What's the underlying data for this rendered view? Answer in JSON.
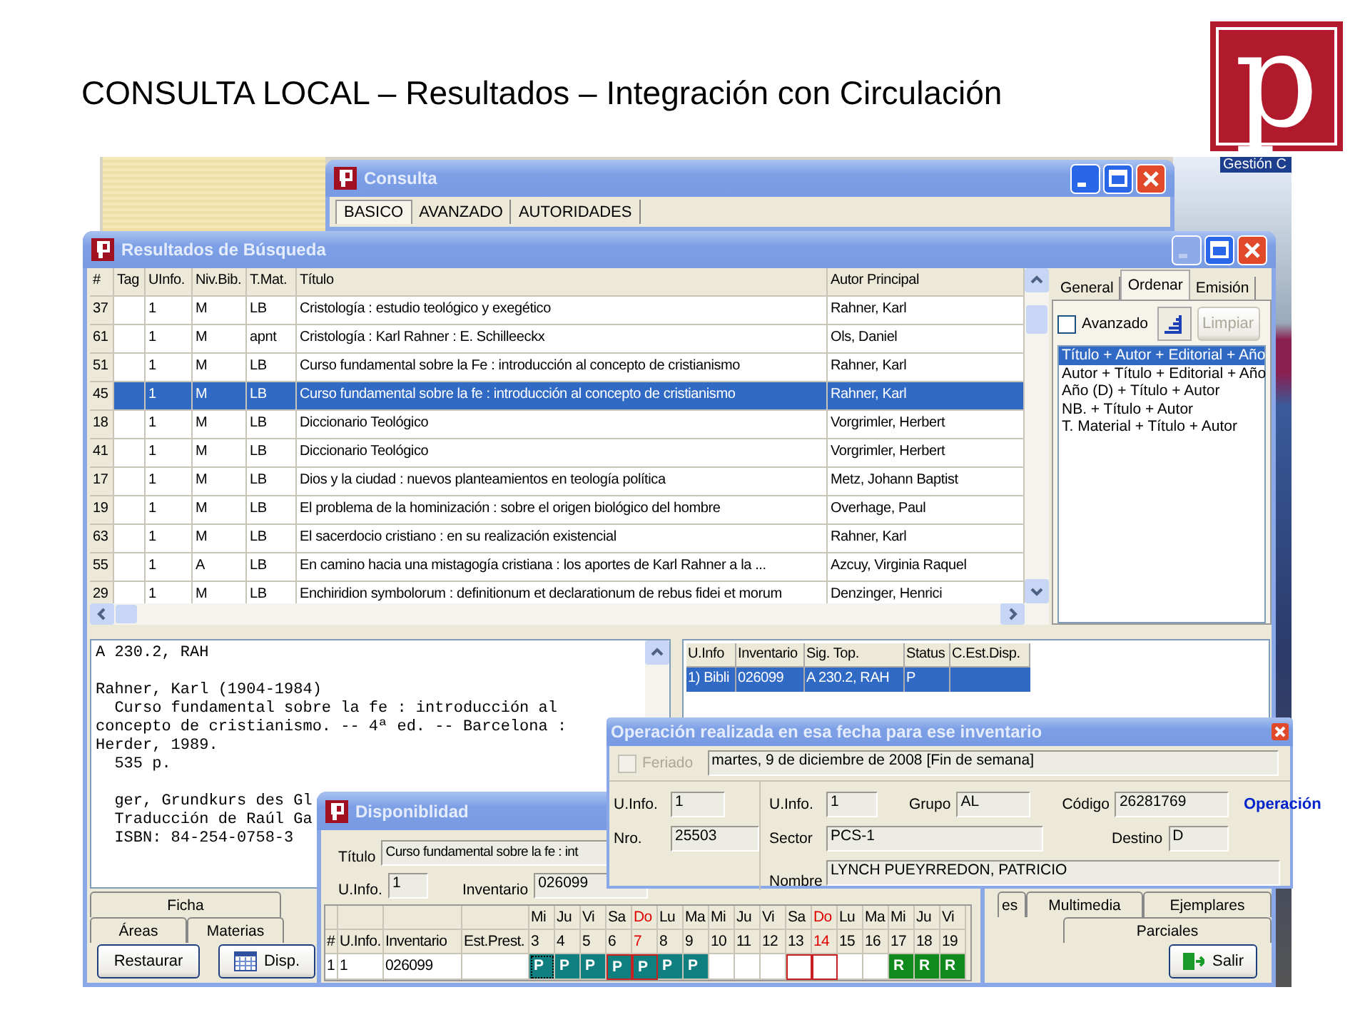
{
  "slide_title": "CONSULTA LOCAL – Resultados – Integración con Circulación",
  "logo_text": "p",
  "desktop_label": "Gestión C",
  "consulta": {
    "title": "Consulta",
    "minimize_enabled": true,
    "tabs": [
      {
        "label": "BASICO",
        "selected": true
      },
      {
        "label": "AVANZADO",
        "selected": false
      },
      {
        "label": "AUTORIDADES",
        "selected": false
      }
    ]
  },
  "resultados": {
    "title": "Resultados de Búsqueda",
    "minimize_enabled": false,
    "table": {
      "columns": [
        "#",
        "Tag",
        "UInfo.",
        "Niv.Bib.",
        "T.Mat.",
        "Título",
        "Autor Principal"
      ],
      "rows": [
        {
          "num": "37",
          "uinfo": "1",
          "niv": "M",
          "tmat": "LB",
          "titulo": "Cristología : estudio teológico y exegético",
          "autor": "Rahner, Karl",
          "selected": false
        },
        {
          "num": "61",
          "uinfo": "1",
          "niv": "M",
          "tmat": "apnt",
          "titulo": "Cristología : Karl Rahner : E. Schilleeckx",
          "autor": "Ols, Daniel",
          "selected": false
        },
        {
          "num": "51",
          "uinfo": "1",
          "niv": "M",
          "tmat": "LB",
          "titulo": "Curso fundamental sobre la Fe : introducción al concepto de cristianismo",
          "autor": "Rahner, Karl",
          "selected": false
        },
        {
          "num": "45",
          "uinfo": "1",
          "niv": "M",
          "tmat": "LB",
          "titulo": "Curso fundamental sobre la fe : introducción al concepto de cristianismo",
          "autor": "Rahner, Karl",
          "selected": true
        },
        {
          "num": "18",
          "uinfo": "1",
          "niv": "M",
          "tmat": "LB",
          "titulo": "Diccionario Teológico",
          "autor": "Vorgrimler, Herbert",
          "selected": false
        },
        {
          "num": "41",
          "uinfo": "1",
          "niv": "M",
          "tmat": "LB",
          "titulo": "Diccionario Teológico",
          "autor": "Vorgrimler, Herbert",
          "selected": false
        },
        {
          "num": "17",
          "uinfo": "1",
          "niv": "M",
          "tmat": "LB",
          "titulo": "Dios y la ciudad : nuevos planteamientos en teología política",
          "autor": "Metz, Johann Baptist",
          "selected": false
        },
        {
          "num": "19",
          "uinfo": "1",
          "niv": "M",
          "tmat": "LB",
          "titulo": "El problema de la hominización : sobre el origen biológico del hombre",
          "autor": "Overhage, Paul",
          "selected": false
        },
        {
          "num": "63",
          "uinfo": "1",
          "niv": "M",
          "tmat": "LB",
          "titulo": "El sacerdocio cristiano : en su realización existencial",
          "autor": "Rahner, Karl",
          "selected": false
        },
        {
          "num": "55",
          "uinfo": "1",
          "niv": "A",
          "tmat": "LB",
          "titulo": "En camino hacia una mistagogía cristiana : los aportes de Karl Rahner a la ...",
          "autor": "Azcuy, Virginia Raquel",
          "selected": false
        },
        {
          "num": "29",
          "uinfo": "1",
          "niv": "M",
          "tmat": "LB",
          "titulo": "Enchiridion symbolorum : definitionum et declarationum de rebus fidei et morum",
          "autor": "Denzinger, Henrici",
          "selected": false
        }
      ]
    },
    "side_tabs": [
      {
        "label": "General",
        "selected": false
      },
      {
        "label": "Ordenar",
        "selected": true
      },
      {
        "label": "Emisión",
        "selected": false
      }
    ],
    "avanzado": {
      "label": "Avanzado",
      "checked": false
    },
    "limpiar": {
      "label": "Limpiar",
      "disabled": true
    },
    "sort_options": [
      {
        "label": "Título + Autor + Editorial + Año",
        "selected": true
      },
      {
        "label": "Autor + Título + Editorial + Año",
        "selected": false
      },
      {
        "label": "Año (D) + Título + Autor",
        "selected": false
      },
      {
        "label": "NB. + Título + Autor",
        "selected": false
      },
      {
        "label": "T. Material + Título + Autor",
        "selected": false
      }
    ],
    "record_paragraphs": [
      [
        "A 230.2, RAH"
      ],
      [
        "Rahner, Karl (1904-1984)",
        "  Curso fundamental sobre la fe : introducción al",
        "concepto de cristianismo. -- 4ª ed. -- Barcelona :",
        "Herder, 1989.",
        "  535 p."
      ],
      [
        "  ger, Grundkurs des Gl",
        "  Traducción de Raúl Ga",
        "  ISBN: 84-254-0758-3"
      ]
    ],
    "copies": {
      "columns": [
        "U.Info",
        "Inventario",
        "Sig. Top.",
        "Status",
        "C.Est.Disp."
      ],
      "rows": [
        {
          "cells": [
            "1) Bibli",
            "026099",
            "A 230.2, RAH",
            "P"
          ],
          "selected": true
        }
      ]
    },
    "tabs_left_row1": [
      "Ficha"
    ],
    "tabs_left_row2": [
      "Áreas",
      "Materias"
    ],
    "tabs_right_row1": [
      "es",
      "Multimedia",
      "Ejemplares"
    ],
    "tabs_right_row2": [
      "Parciales"
    ],
    "restaurar": "Restaurar",
    "disp": "Disp.",
    "salir": "Salir"
  },
  "operacion": {
    "title": "Operación realizada en esa fecha para ese inventario",
    "feriado": {
      "label": "Feriado",
      "checked": false,
      "disabled": true
    },
    "date": "martes, 9 de diciembre de 2008  [Fin de semana]",
    "uinfo_left": {
      "label": "U.Info.",
      "value": "1"
    },
    "nro": {
      "label": "Nro.",
      "value": "25503"
    },
    "uinfo": {
      "label": "U.Info.",
      "value": "1"
    },
    "grupo": {
      "label": "Grupo",
      "value": "AL"
    },
    "codigo": {
      "label": "Código",
      "value": "26281769"
    },
    "operacion_label": "Operación",
    "sector": {
      "label": "Sector",
      "value": "PCS-1"
    },
    "destino": {
      "label": "Destino",
      "value": "D"
    },
    "nombre": {
      "label": "Nombre",
      "value": "LYNCH PUEYRREDON, PATRICIO"
    }
  },
  "disponibilidad": {
    "title": "Disponiblidad",
    "titulo": {
      "label": "Título",
      "value": "Curso fundamental sobre la fe : int"
    },
    "uinfo": {
      "label": "U.Info.",
      "value": "1"
    },
    "inventario": {
      "label": "Inventario",
      "value": "026099"
    },
    "columns": [
      "#",
      "U.Info.",
      "Inventario",
      "Est.Prest."
    ],
    "row": [
      "1",
      "1",
      "026099"
    ],
    "days": [
      {
        "weekday": "Mi",
        "day": "3",
        "status": "P",
        "color": "#0f7f7f",
        "sunday": false,
        "outlined": false,
        "focused": true
      },
      {
        "weekday": "Ju",
        "day": "4",
        "status": "P",
        "color": "#0f7f7f",
        "sunday": false,
        "outlined": false,
        "focused": false
      },
      {
        "weekday": "Vi",
        "day": "5",
        "status": "P",
        "color": "#0f7f7f",
        "sunday": false,
        "outlined": false,
        "focused": false
      },
      {
        "weekday": "Sa",
        "day": "6",
        "status": "P",
        "color": "#0f7f7f",
        "sunday": false,
        "outlined": true,
        "focused": false
      },
      {
        "weekday": "Do",
        "day": "7",
        "status": "P",
        "color": "#0f7f7f",
        "sunday": true,
        "outlined": true,
        "focused": false
      },
      {
        "weekday": "Lu",
        "day": "8",
        "status": "P",
        "color": "#0f7f7f",
        "sunday": false,
        "outlined": false,
        "focused": false
      },
      {
        "weekday": "Ma",
        "day": "9",
        "status": "P",
        "color": "#0f7f7f",
        "sunday": false,
        "outlined": false,
        "focused": false
      },
      {
        "weekday": "Mi",
        "day": "10",
        "sunday": false,
        "outlined": false,
        "focused": false
      },
      {
        "weekday": "Ju",
        "day": "11",
        "sunday": false,
        "outlined": false,
        "focused": false
      },
      {
        "weekday": "Vi",
        "day": "12",
        "sunday": false,
        "outlined": false,
        "focused": false
      },
      {
        "weekday": "Sa",
        "day": "13",
        "sunday": false,
        "outlined": true,
        "focused": false
      },
      {
        "weekday": "Do",
        "day": "14",
        "sunday": true,
        "outlined": true,
        "focused": false
      },
      {
        "weekday": "Lu",
        "day": "15",
        "sunday": false,
        "outlined": false,
        "focused": false
      },
      {
        "weekday": "Ma",
        "day": "16",
        "sunday": false,
        "outlined": false,
        "focused": false
      },
      {
        "weekday": "Mi",
        "day": "17",
        "status": "R",
        "color": "#108a1c",
        "sunday": false,
        "outlined": false,
        "focused": false
      },
      {
        "weekday": "Ju",
        "day": "18",
        "status": "R",
        "color": "#108a1c",
        "sunday": false,
        "outlined": false,
        "focused": false
      },
      {
        "weekday": "Vi",
        "day": "19",
        "status": "R",
        "color": "#108a1c",
        "sunday": false,
        "outlined": false,
        "focused": false
      }
    ]
  }
}
